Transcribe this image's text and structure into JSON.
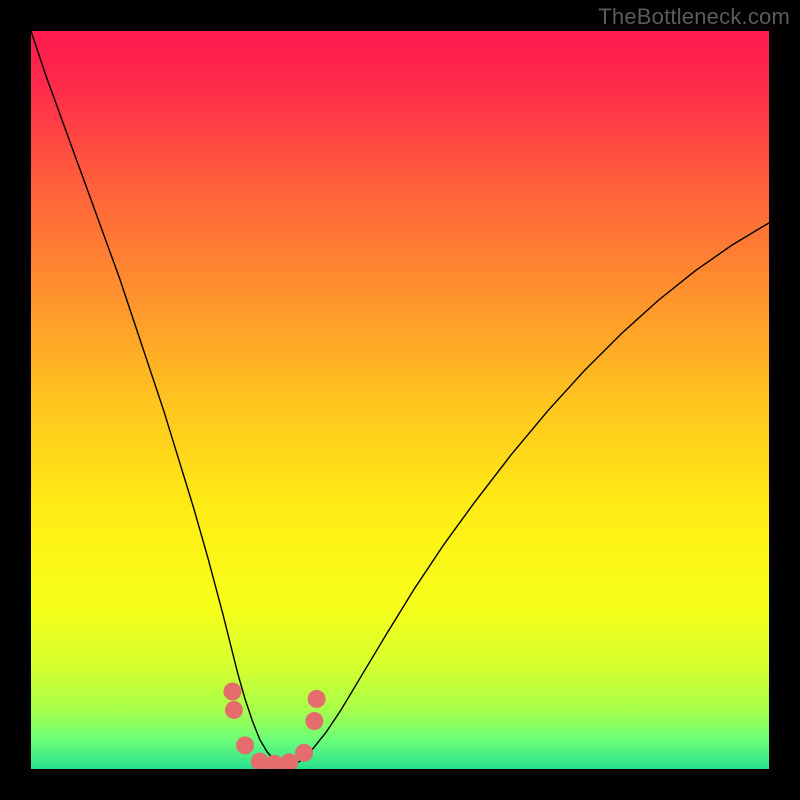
{
  "watermark": "TheBottleneck.com",
  "chart_data": {
    "type": "line",
    "title": "",
    "xlabel": "",
    "ylabel": "",
    "xlim": [
      0,
      100
    ],
    "ylim": [
      0,
      100
    ],
    "grid": false,
    "legend": false,
    "background_gradient": {
      "stops": [
        {
          "offset": 0.0,
          "color": "#ff1a4e"
        },
        {
          "offset": 0.08,
          "color": "#ff2c4a"
        },
        {
          "offset": 0.2,
          "color": "#ff5d3d"
        },
        {
          "offset": 0.35,
          "color": "#ff8f2e"
        },
        {
          "offset": 0.5,
          "color": "#ffc41f"
        },
        {
          "offset": 0.65,
          "color": "#ffed15"
        },
        {
          "offset": 0.78,
          "color": "#f7ff1a"
        },
        {
          "offset": 0.86,
          "color": "#d6ff2e"
        },
        {
          "offset": 0.92,
          "color": "#a8ff4a"
        },
        {
          "offset": 0.96,
          "color": "#6bff78"
        },
        {
          "offset": 1.0,
          "color": "#29e08e"
        }
      ]
    },
    "series": [
      {
        "name": "bottleneck-curve",
        "color": "#000000",
        "width": 1.4,
        "x": [
          0,
          2,
          4,
          6,
          8,
          10,
          12,
          14,
          16,
          18,
          20,
          22,
          24,
          26,
          27,
          28,
          29,
          30,
          31,
          32,
          33,
          34,
          35,
          36,
          37,
          38,
          40,
          42,
          45,
          48,
          52,
          56,
          60,
          65,
          70,
          75,
          80,
          85,
          90,
          95,
          100
        ],
        "y": [
          100,
          94,
          88.5,
          83,
          77.5,
          72,
          66.5,
          60.5,
          54.5,
          48.5,
          42,
          35.5,
          28.5,
          21,
          17,
          13,
          9.5,
          6.5,
          4,
          2.3,
          1.2,
          0.7,
          0.6,
          0.8,
          1.4,
          2.5,
          5,
          8,
          13,
          18,
          24.5,
          30.5,
          36,
          42.5,
          48.5,
          54,
          59,
          63.5,
          67.5,
          71,
          74
        ]
      }
    ],
    "markers": {
      "name": "dip-dots",
      "color": "#e46c6c",
      "x": [
        27.3,
        27.5,
        29.0,
        31.0,
        33.0,
        35.0,
        37.0,
        38.4,
        38.7
      ],
      "y": [
        10.5,
        8.0,
        3.2,
        1.0,
        0.7,
        0.9,
        2.2,
        6.5,
        9.5
      ],
      "r": 9
    }
  }
}
